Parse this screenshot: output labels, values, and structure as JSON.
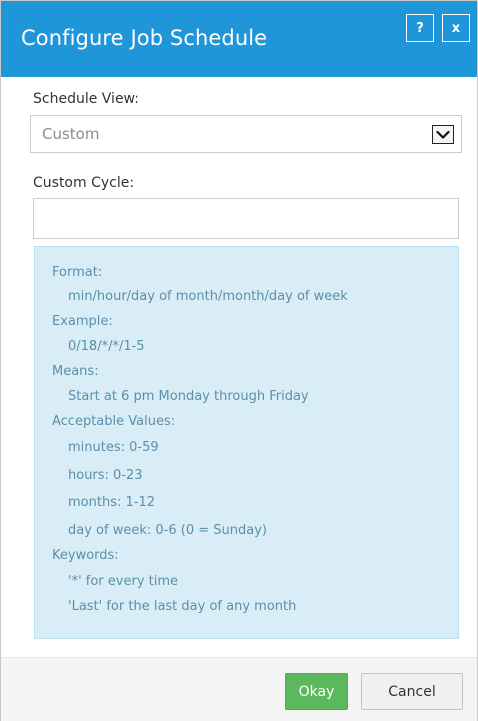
{
  "dialog": {
    "title": "Configure Job Schedule",
    "help_label": "?",
    "close_label": "x"
  },
  "schedule_view": {
    "label": "Schedule View:",
    "selected": "Custom"
  },
  "custom_cycle": {
    "label": "Custom Cycle:",
    "value": "",
    "placeholder": ""
  },
  "help_text": {
    "format_label": "Format:",
    "format_value": "min/hour/day of month/month/day of week",
    "example_label": "Example:",
    "example_value": "0/18/*/*/1-5",
    "means_label": "Means:",
    "means_value": "Start at 6 pm Monday through Friday",
    "acceptable_label": "Acceptable Values:",
    "minutes": "minutes: 0-59",
    "hours": "hours: 0-23",
    "months": "months: 1-12",
    "day_of_week": "day of week: 0-6 (0 = Sunday)",
    "keywords_label": "Keywords:",
    "keyword_star": "'*' for every time",
    "keyword_last": "'Last' for the last day of any month"
  },
  "footer": {
    "okay_label": "Okay",
    "cancel_label": "Cancel"
  },
  "colors": {
    "titlebar": "#1e96d7",
    "info_bg": "#d9edf7",
    "info_text": "#5c8fa8",
    "okay_bg": "#5cb85c"
  },
  "icons": [
    "help-icon",
    "close-icon",
    "chevron-down-icon"
  ]
}
